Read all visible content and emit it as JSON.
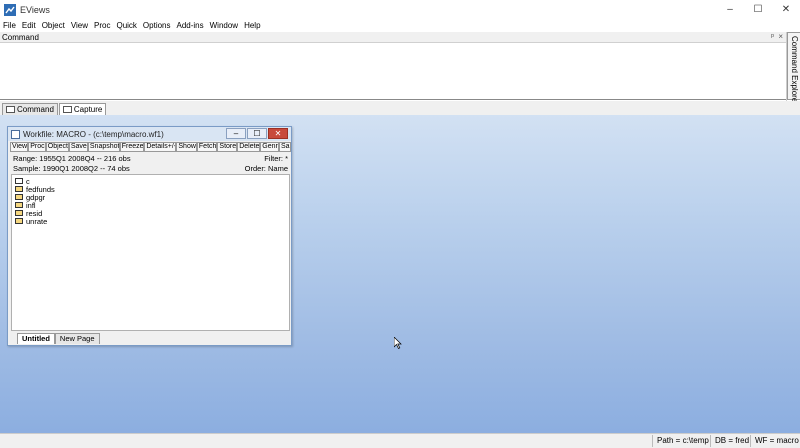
{
  "window": {
    "title": "EViews",
    "controls": [
      "–",
      "☐",
      "✕"
    ]
  },
  "menubar": [
    "File",
    "Edit",
    "Object",
    "View",
    "Proc",
    "Quick",
    "Options",
    "Add-ins",
    "Window",
    "Help"
  ],
  "command_pane": {
    "header": "Command",
    "pin": "ᵖ",
    "close": "×"
  },
  "command_explorer": {
    "label": "Command Explorer"
  },
  "command_tabs": [
    "Command",
    "Capture"
  ],
  "workfile": {
    "title": "Workfile: MACRO - (c:\\temp\\macro.wf1)",
    "toolbar": [
      "View",
      "Proc",
      "Object",
      "Save",
      "Snapshot",
      "Freeze",
      "Details+/-",
      "Show",
      "Fetch",
      "Store",
      "Delete",
      "Genr",
      "Sa"
    ],
    "range_label": "Range:  1955Q1 2008Q4  --  216 obs",
    "filter": "Filter: *",
    "sample_label": "Sample: 1990Q1 2008Q2  --  74 obs",
    "order": "Order: Name",
    "objects": [
      {
        "name": "c",
        "icon": "coef-icon"
      },
      {
        "name": "fedfunds",
        "icon": "series-icon"
      },
      {
        "name": "gdpgr",
        "icon": "series-icon"
      },
      {
        "name": "infl",
        "icon": "series-icon"
      },
      {
        "name": "resid",
        "icon": "series-icon"
      },
      {
        "name": "unrate",
        "icon": "series-icon"
      }
    ],
    "pages": [
      "Untitled",
      "New Page"
    ]
  },
  "statusbar": {
    "path": "Path = c:\\temp",
    "db": "DB = fred",
    "wf": "WF = macro"
  },
  "colors": {
    "desktop_top": "#d2e1f3",
    "desktop_bottom": "#8caee0",
    "close_red": "#c84a3c"
  }
}
